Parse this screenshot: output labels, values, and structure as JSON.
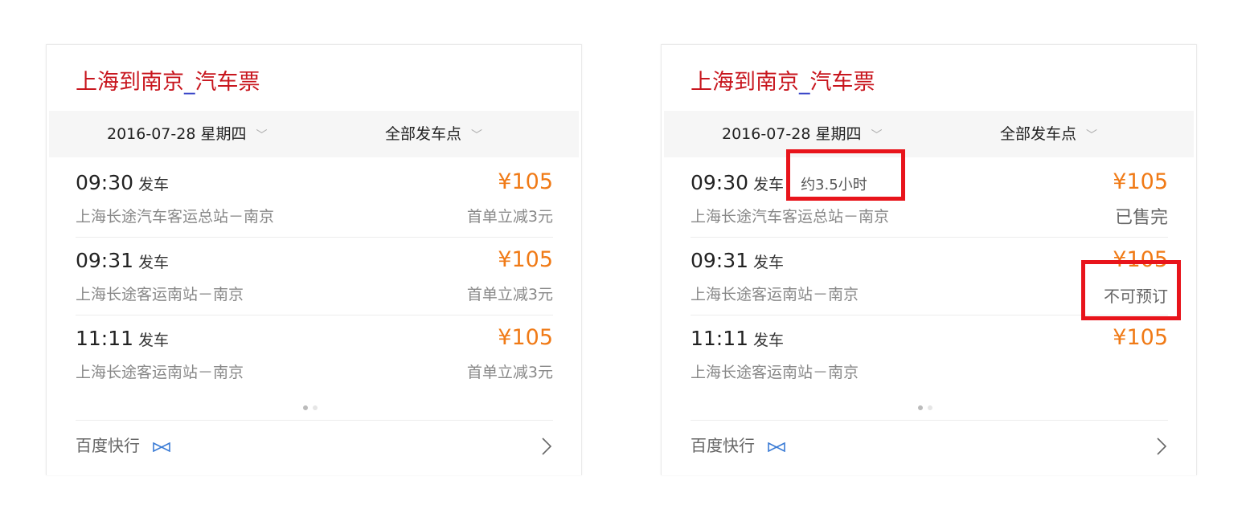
{
  "colors": {
    "title": "#c8161e",
    "price": "#f07a16",
    "highlight": "#e8141b"
  },
  "left": {
    "title_a": "上海到南京",
    "title_sep": "_",
    "title_b": "汽车票",
    "date": "2016-07-28 星期四",
    "station_filter": "全部发车点",
    "trips": [
      {
        "time": "09:30",
        "dep": "发车",
        "route": "上海长途汽车客运总站－南京",
        "price": "¥105",
        "note": "首单立减3元"
      },
      {
        "time": "09:31",
        "dep": "发车",
        "route": "上海长途客运南站－南京",
        "price": "¥105",
        "note": "首单立减3元"
      },
      {
        "time": "11:11",
        "dep": "发车",
        "route": "上海长途客运南站－南京",
        "price": "¥105",
        "note": "首单立减3元"
      }
    ],
    "footer": "百度快行"
  },
  "right": {
    "title_a": "上海到南京",
    "title_sep": "_",
    "title_b": "汽车票",
    "date": "2016-07-28 星期四",
    "station_filter": "全部发车点",
    "trips": [
      {
        "time": "09:30",
        "dep": "发车",
        "duration": "约3.5小时",
        "route": "上海长途汽车客运总站－南京",
        "price": "¥105",
        "note": "已售完"
      },
      {
        "time": "09:31",
        "dep": "发车",
        "route": "上海长途客运南站－南京",
        "price": "¥105",
        "note": "不可预订"
      },
      {
        "time": "11:11",
        "dep": "发车",
        "route": "上海长途客运南站－南京",
        "price": "¥105",
        "note": ""
      }
    ],
    "footer": "百度快行"
  }
}
